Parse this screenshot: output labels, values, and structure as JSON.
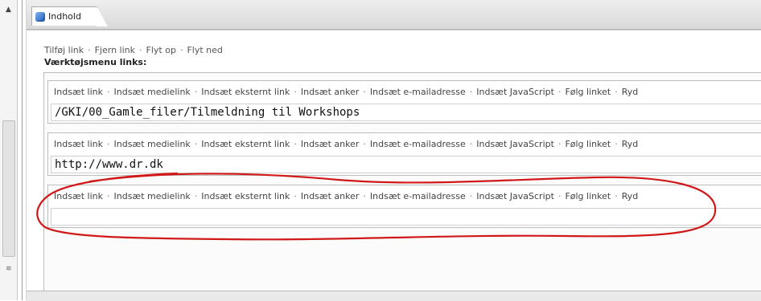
{
  "tab": {
    "label": "Indhold",
    "icon": "cube-icon"
  },
  "top_links": [
    "Tilføj link",
    "Fjern link",
    "Flyt op",
    "Flyt ned"
  ],
  "section_title": "Værktøjsmenu links:",
  "toolbar_actions": [
    "Indsæt link",
    "Indsæt medielink",
    "Indsæt eksternt link",
    "Indsæt anker",
    "Indsæt e-mailadresse",
    "Indsæt JavaScript",
    "Følg linket",
    "Ryd"
  ],
  "rows": [
    {
      "value": "/GKI/00_Gamle_filer/Tilmeldning til Workshops"
    },
    {
      "value": "http://www.dr.dk"
    },
    {
      "value": ""
    }
  ],
  "annotation_color": "#d01818",
  "separator": "·"
}
